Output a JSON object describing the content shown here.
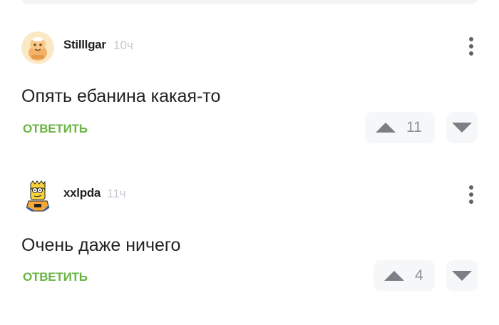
{
  "comments": [
    {
      "author": "Stilllgar",
      "time": "10ч",
      "text": "Опять ебанина какая-то",
      "reply_label": "ОТВЕТИТЬ",
      "score": "11",
      "avatar_icon": "cartoon-character-avatar"
    },
    {
      "author": "xxlpda",
      "time": "11ч",
      "text": "Очень даже ничего",
      "reply_label": "ОТВЕТИТЬ",
      "score": "4",
      "avatar_icon": "bart-simpson-avatar"
    }
  ],
  "colors": {
    "accent_green": "#69b443",
    "button_bg": "#f6f7f8",
    "icon_gray": "#7b7f86",
    "muted_text": "#c6c9cf"
  }
}
